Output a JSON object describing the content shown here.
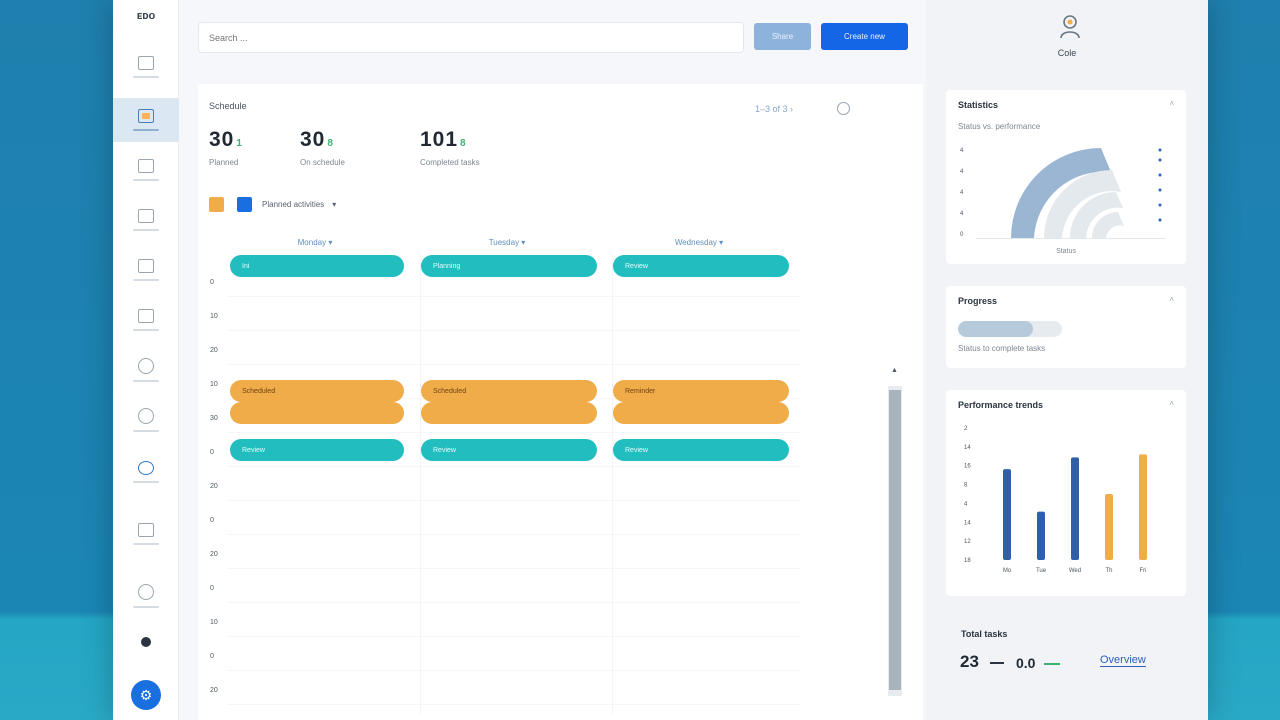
{
  "sidebar": {
    "logo": "ᴇᴅᴏ",
    "items": [
      {
        "icon": "dashboard-icon"
      },
      {
        "icon": "calendar-icon",
        "active": true
      },
      {
        "icon": "clipboard-icon"
      },
      {
        "icon": "document-icon"
      },
      {
        "icon": "image-icon"
      },
      {
        "icon": "list-icon"
      },
      {
        "icon": "search-icon"
      },
      {
        "icon": "clock-icon"
      },
      {
        "icon": "globe-icon"
      },
      {
        "icon": "file-icon"
      },
      {
        "icon": "info-icon"
      },
      {
        "icon": "settings-icon"
      }
    ],
    "fab_label": "⚙"
  },
  "topbar": {
    "search_placeholder": "Search ...",
    "secondary_button": "Share",
    "primary_button": "Create new"
  },
  "main": {
    "section_title": "Schedule",
    "paging": "1–3 of 3  ›",
    "kpis": [
      {
        "value": "30",
        "accent": "1",
        "label": "Planned"
      },
      {
        "value": "30",
        "accent": "8",
        "label": "On schedule"
      },
      {
        "value": "101",
        "accent": "8",
        "label": "Completed tasks"
      }
    ],
    "legend": {
      "colors": [
        "#f1ac4a",
        "#1a6fe0"
      ],
      "label": "Planned activities",
      "caret": "▾"
    },
    "columns": [
      "Monday ▾",
      "Tuesday ▾",
      "Wednesday ▾"
    ],
    "row_labels": [
      "0",
      "10",
      "20",
      "10",
      "30",
      "0",
      "20",
      "0",
      "20",
      "0",
      "10",
      "0",
      "20"
    ],
    "pill_rows": [
      {
        "color": "teal",
        "labels": [
          "Ini",
          "Planning",
          "Review"
        ]
      },
      {
        "color": "orange",
        "labels": [
          "Scheduled",
          "Scheduled",
          "Reminder"
        ]
      },
      {
        "color": "orange",
        "labels": [
          "",
          "",
          ""
        ]
      },
      {
        "color": "teal",
        "labels": [
          "Review",
          "Review",
          "Review"
        ]
      }
    ],
    "scroll_arrow": "▲"
  },
  "right": {
    "user_name": "Cole",
    "card1": {
      "title": "Statistics",
      "subtitle": "Status vs. performance",
      "caret": "˄",
      "y_ticks": [
        "4",
        "4",
        "4",
        "4",
        "0"
      ],
      "footer": "Status"
    },
    "card2": {
      "title": "Progress",
      "caret": "˄",
      "progress_fraction": 0.72,
      "subtitle": "Status to complete tasks"
    },
    "card3": {
      "title": "Performance trends",
      "caret": "˄",
      "y_ticks": [
        "2",
        "14",
        "16",
        "8",
        "4",
        "14",
        "12",
        "18"
      ]
    },
    "totals": {
      "title": "Total tasks",
      "value1": "23",
      "value2": "0.0",
      "link": "Overview"
    }
  },
  "chart_data": [
    {
      "type": "bar",
      "title": "Performance trends",
      "categories": [
        "Mo",
        "Tue",
        "Wed",
        "Th",
        "Fri"
      ],
      "values": [
        62,
        33,
        70,
        45,
        72
      ],
      "colors": [
        "#2f5fa8",
        "#2f5fa8",
        "#2f5fa8",
        "#f1ac4a",
        "#f1ac4a"
      ],
      "ylim": [
        0,
        90
      ]
    }
  ]
}
